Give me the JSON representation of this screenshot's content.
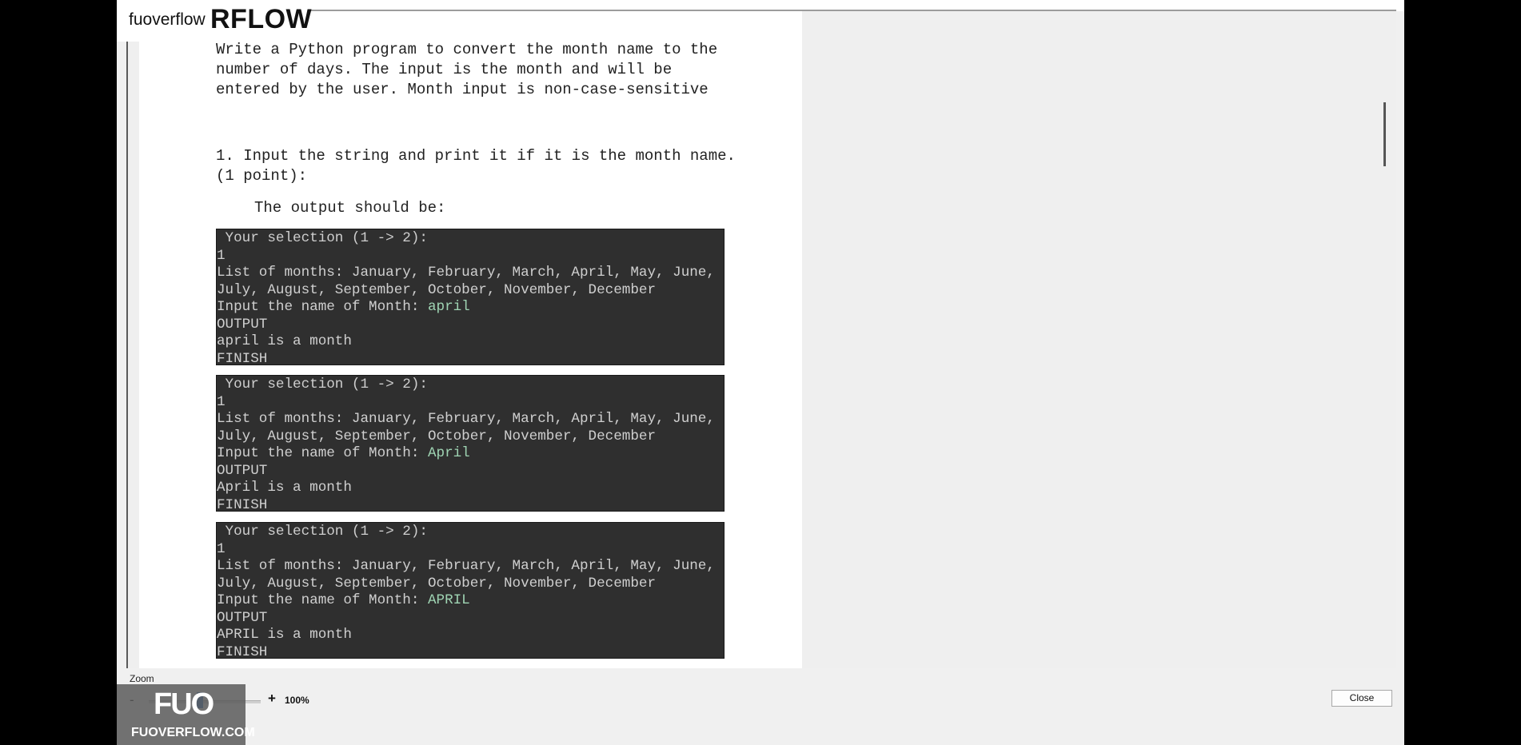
{
  "brand": {
    "small": "fuoverflow",
    "big": "RFLOW"
  },
  "document": {
    "intro": "Write a Python program to convert the month name to the number of days. The input is the month and will be entered by the user. Month input is non-case-sensitive",
    "task1": "1. Input the string and print it if it is the month name. (1 point):",
    "output_label": "The output should be:",
    "terminals": [
      {
        "selection": " Your selection (1 -> 2):",
        "choice": "1",
        "months_line1": "List of months: January, February, March, April, May, June,",
        "months_line2": "July, August, September, October, November, December",
        "prompt": "Input the name of Month: ",
        "input": "april",
        "output_label": "OUTPUT",
        "result": "april is a month",
        "finish": "FINISH"
      },
      {
        "selection": " Your selection (1 -> 2):",
        "choice": "1",
        "months_line1": "List of months: January, February, March, April, May, June,",
        "months_line2": "July, August, September, October, November, December",
        "prompt": "Input the name of Month: ",
        "input": "April",
        "output_label": "OUTPUT",
        "result": "April is a month",
        "finish": "FINISH"
      },
      {
        "selection": " Your selection (1 -> 2):",
        "choice": "1",
        "months_line1": "List of months: January, February, March, April, May, June,",
        "months_line2": "July, August, September, October, November, December",
        "prompt": "Input the name of Month: ",
        "input": "APRIL",
        "output_label": "OUTPUT",
        "result": "APRIL is a month",
        "finish": "FINISH"
      }
    ]
  },
  "zoom": {
    "label": "Zoom",
    "minus": "-",
    "plus": "+",
    "value": "100%"
  },
  "close_label": "Close",
  "watermark": {
    "logo": "FUO",
    "url": "FUOVERFLOW.COM"
  }
}
